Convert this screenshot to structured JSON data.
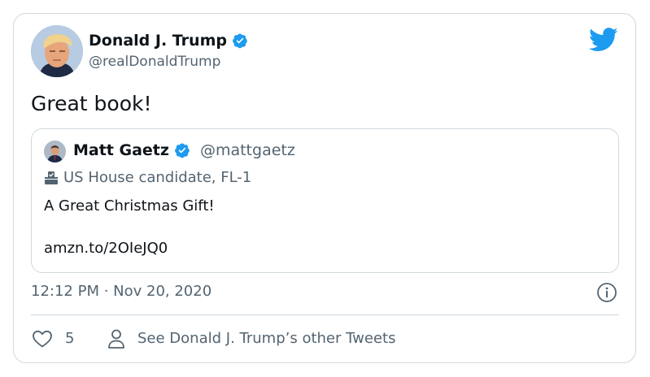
{
  "tweet": {
    "author_name": "Donald J. Trump",
    "author_handle": "@realDonaldTrump",
    "text": "Great book!",
    "timestamp": "12:12 PM · Nov 20, 2020",
    "like_count": "5",
    "see_more_label": "See Donald J. Trump’s other Tweets"
  },
  "quoted_tweet": {
    "author_name": "Matt Gaetz",
    "author_handle": "@mattgaetz",
    "label": "US House candidate, FL-1",
    "text": "A Great Christmas Gift!",
    "link": "amzn.to/2OIeJQ0"
  },
  "icons": {
    "brand": "twitter-bird-icon",
    "verified": "verified-badge-icon",
    "label": "ballot-box-icon",
    "info": "info-icon",
    "like": "heart-icon",
    "profile": "person-icon"
  },
  "colors": {
    "twitter_blue": "#1d9bf0",
    "text_primary": "#0f1419",
    "text_secondary": "#536471",
    "border": "#cfd9de"
  }
}
